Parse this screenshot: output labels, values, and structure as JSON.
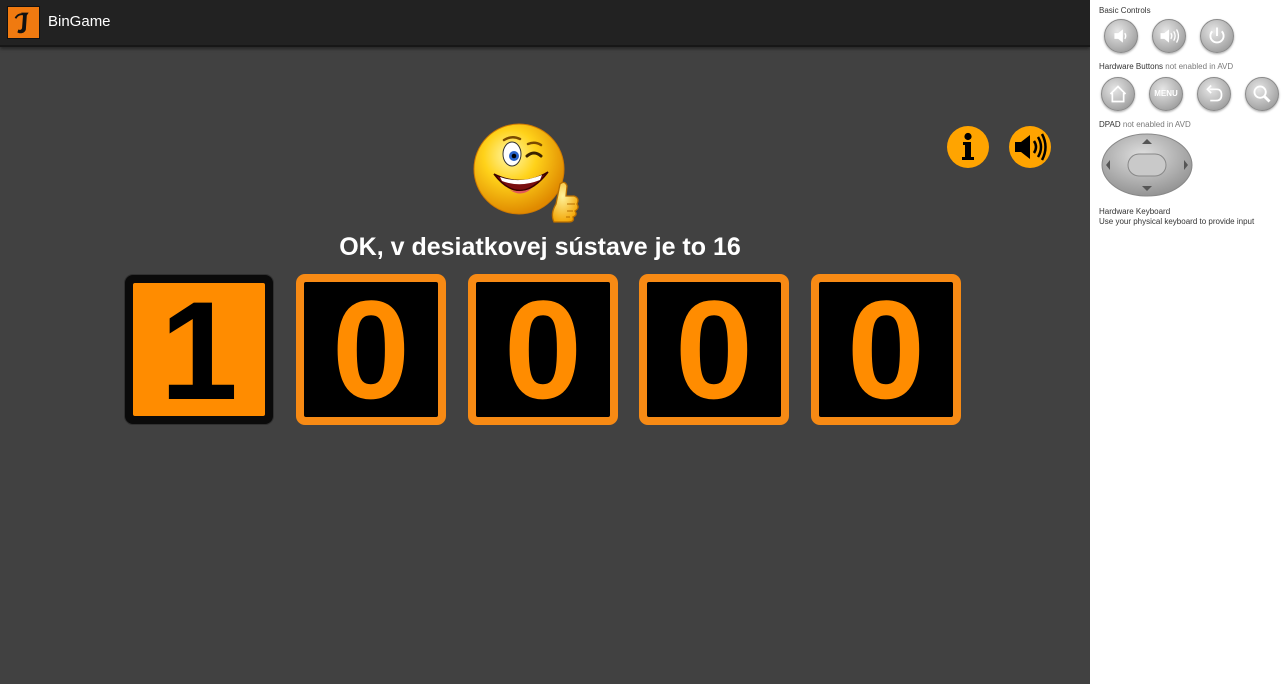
{
  "app": {
    "title": "BinGame",
    "message": "OK, v desiatkovej sústave je to 16",
    "digits": [
      "1",
      "0",
      "0",
      "0",
      "0"
    ],
    "digit_states": [
      "on",
      "off",
      "off",
      "off",
      "off"
    ],
    "accent": "#ff8c00",
    "icons": {
      "logo": "app-logo-icon",
      "smiley": "winking-smiley-thumbs-up-icon",
      "info": "info-icon",
      "sound": "speaker-icon"
    }
  },
  "emulator_panel": {
    "basic_controls_label": "Basic Controls",
    "hardware_buttons_label": "Hardware Buttons",
    "hardware_buttons_note": "not enabled in AVD",
    "dpad_label": "DPAD",
    "dpad_note": "not enabled in AVD",
    "keyboard_label": "Hardware Keyboard",
    "keyboard_note": "Use your physical keyboard to provide input",
    "menu_label": "MENU",
    "basic_buttons": [
      "volume-down-icon",
      "volume-up-icon",
      "power-icon"
    ],
    "hardware_buttons": [
      "home-icon",
      "menu-icon",
      "back-icon",
      "search-icon"
    ]
  }
}
